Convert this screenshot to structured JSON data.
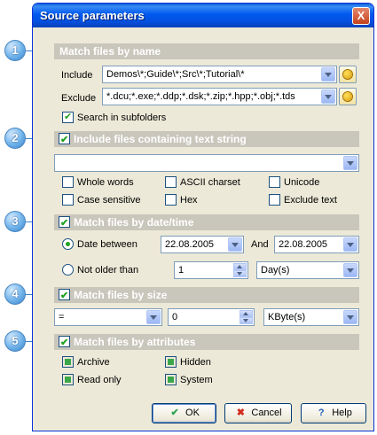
{
  "window": {
    "title": "Source parameters",
    "close_label": "X"
  },
  "badges": [
    "1",
    "2",
    "3",
    "4",
    "5"
  ],
  "name_section": {
    "title": "Match files by name",
    "include_label": "Include",
    "include_value": "Demos\\*;Guide\\*;Src\\*;Tutorial\\*",
    "exclude_label": "Exclude",
    "exclude_value": "*.dcu;*.exe;*.ddp;*.dsk;*.zip;*.hpp;*.obj;*.tds",
    "subfolders_label": "Search in subfolders",
    "subfolders_checked": true
  },
  "text_section": {
    "title": "Include files containing text string",
    "checked": true,
    "text_value": "",
    "options": [
      {
        "label": "Whole words",
        "checked": false
      },
      {
        "label": "ASCII charset",
        "checked": false
      },
      {
        "label": "Unicode",
        "checked": false
      },
      {
        "label": "Case sensitive",
        "checked": false
      },
      {
        "label": "Hex",
        "checked": false
      },
      {
        "label": "Exclude text",
        "checked": false
      }
    ]
  },
  "date_section": {
    "title": "Match files by date/time",
    "checked": true,
    "between_label": "Date between",
    "from_date": "22.08.2005",
    "and_label": "And",
    "to_date": "22.08.2005",
    "older_label": "Not older than",
    "older_value": "1",
    "older_unit": "Day(s)",
    "selected": "between"
  },
  "size_section": {
    "title": "Match files by size",
    "checked": true,
    "operator": "=",
    "size_value": "0",
    "size_unit": "KByte(s)"
  },
  "attr_section": {
    "title": "Match files by attributes",
    "checked": true,
    "attributes": [
      {
        "label": "Archive",
        "state": "indeterminate"
      },
      {
        "label": "Hidden",
        "state": "indeterminate"
      },
      {
        "label": "Read only",
        "state": "indeterminate"
      },
      {
        "label": "System",
        "state": "indeterminate"
      }
    ]
  },
  "buttons": {
    "ok": "OK",
    "cancel": "Cancel",
    "help": "Help"
  },
  "colors": {
    "titlebar": "#0058ee",
    "section_bg": "#c9c6bc",
    "check": "#21a121",
    "badge": "#6fb2ea"
  }
}
